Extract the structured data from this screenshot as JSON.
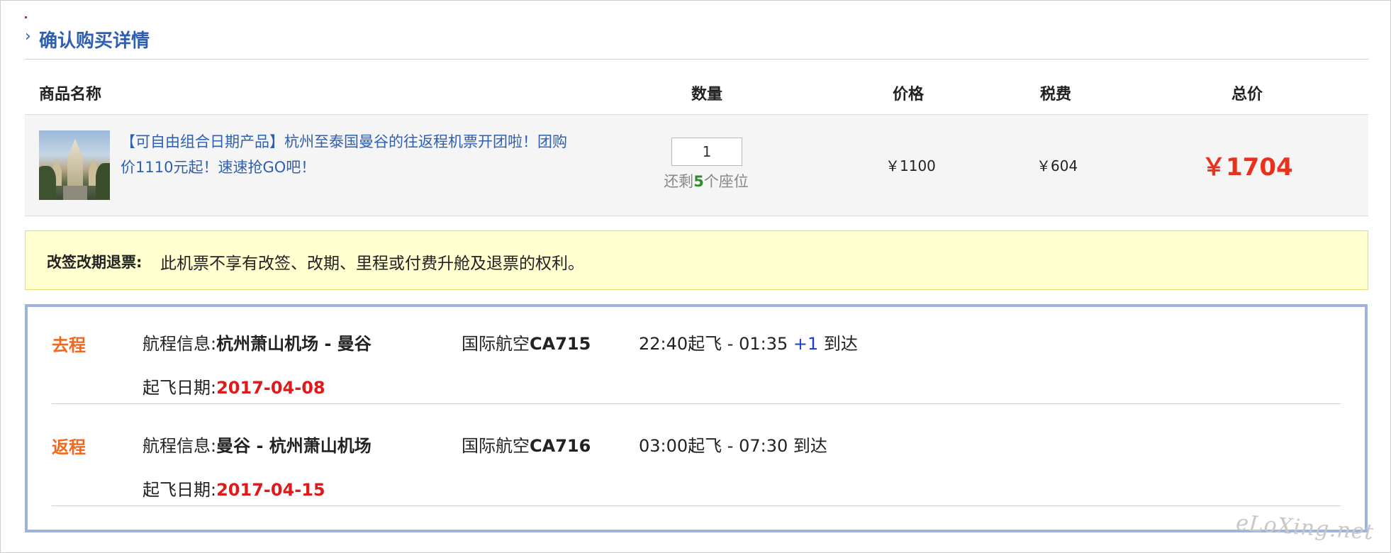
{
  "section": {
    "title": "确认购买详情",
    "chevron_icon": "chevron-right-icon"
  },
  "table": {
    "headers": {
      "name": "商品名称",
      "qty": "数量",
      "price": "价格",
      "tax": "税费",
      "total": "总价"
    },
    "row": {
      "name": "【可自由组合日期产品】杭州至泰国曼谷的往返程机票开团啦！团购价1110元起！速速抢GO吧！",
      "qty_value": "1",
      "remain_prefix": "还剩",
      "remain_count": "5",
      "remain_suffix": "个座位",
      "price": "￥1100",
      "tax": "￥604",
      "total": "￥1704"
    }
  },
  "notice": {
    "label": "改签改期退票:",
    "text": "此机票不享有改签、改期、里程或付费升舱及退票的权利。"
  },
  "flights": [
    {
      "type": "去程",
      "route_label": "航程信息:",
      "route": "杭州萧山机场 - 曼谷",
      "airline": "国际航空",
      "flight_no": "CA715",
      "time": "22:40起飞 - 01:35",
      "plus": "+1",
      "arrive": "到达",
      "date_label": "起飞日期:",
      "date": "2017-04-08"
    },
    {
      "type": "返程",
      "route_label": "航程信息:",
      "route": "曼谷 - 杭州萧山机场",
      "airline": "国际航空",
      "flight_no": "CA716",
      "time": "03:00起飞 - 07:30",
      "plus": "",
      "arrive": "到达",
      "date_label": "起飞日期:",
      "date": "2017-04-15"
    }
  ],
  "watermark": "eLoXing.net",
  "colors": {
    "link_blue": "#2f5fb0",
    "price_red": "#e8321d",
    "leg_orange": "#f06a1e",
    "seat_green": "#2e8b2e",
    "notice_bg": "#ffffcf",
    "flight_border": "#9fb4dd"
  }
}
